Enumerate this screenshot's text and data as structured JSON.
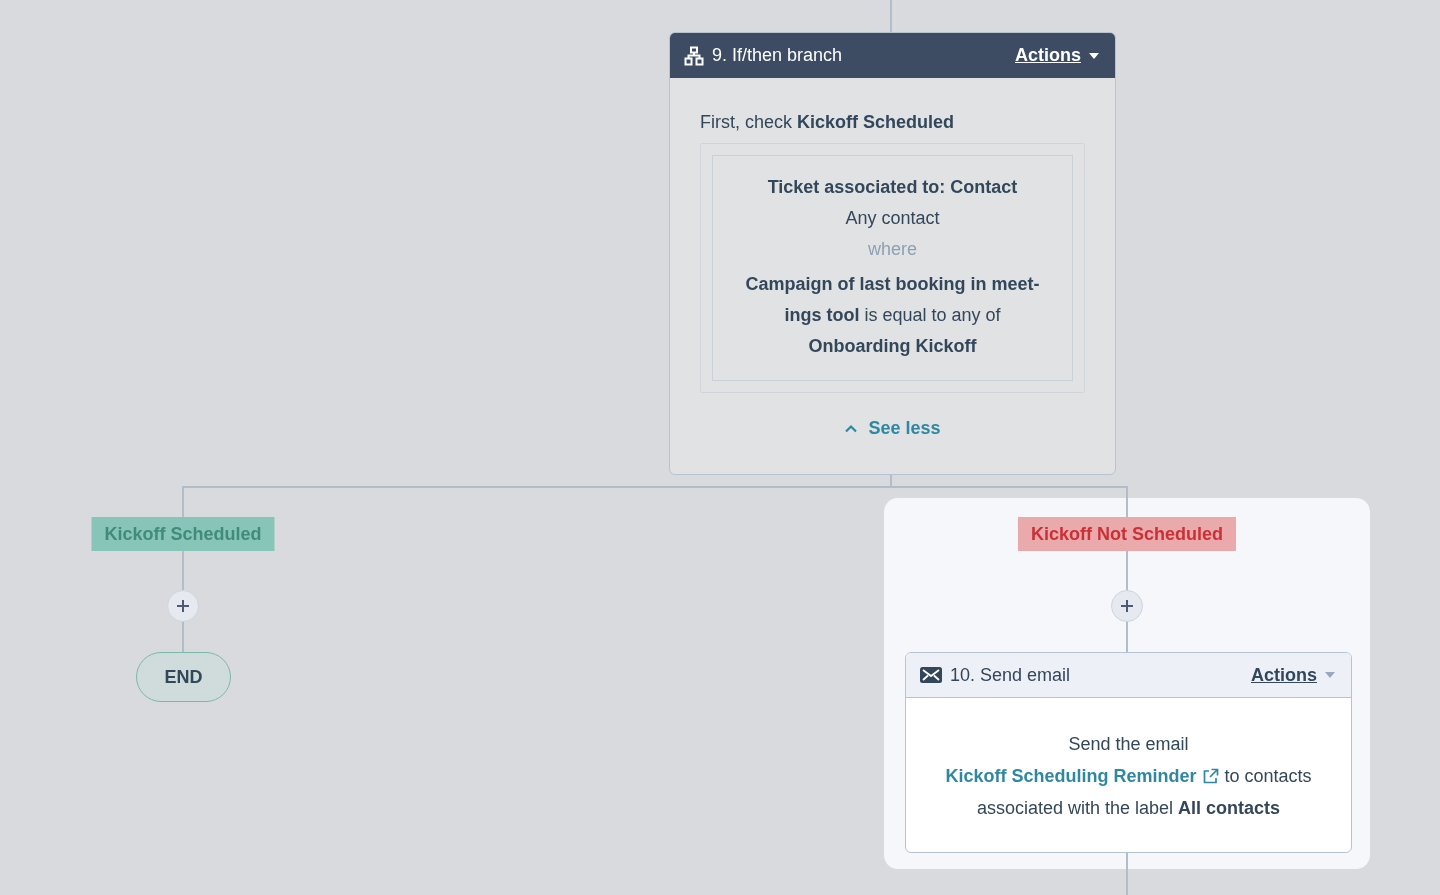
{
  "branch_action": {
    "title": "9. If/then branch",
    "actions": "Actions",
    "intro": "First, check **Kickoff Scheduled**",
    "condition": {
      "object": "Ticket associated to: Contact",
      "quantifier": "Any contact",
      "joiner": "where",
      "rule": "**Campaign of last booking in meet-ings tool** is equal to any of",
      "value": "Onboarding Kickoff"
    },
    "toggle": "See less"
  },
  "branches": [
    {
      "label": "Kickoff Scheduled",
      "color": "#86c5b8",
      "selected": false,
      "next": {
        "kind": "end",
        "label": "END"
      }
    },
    {
      "label": "Kickoff Not Scheduled",
      "color": "#eaa9ab",
      "selected": true,
      "next": {
        "kind": "email",
        "title": "10. Send email",
        "actions": "Actions",
        "prefix": "Send the email",
        "link": "Kickoff Scheduling Reminder",
        "suffix": "to contacts associated with the label **All contacts**"
      }
    }
  ]
}
